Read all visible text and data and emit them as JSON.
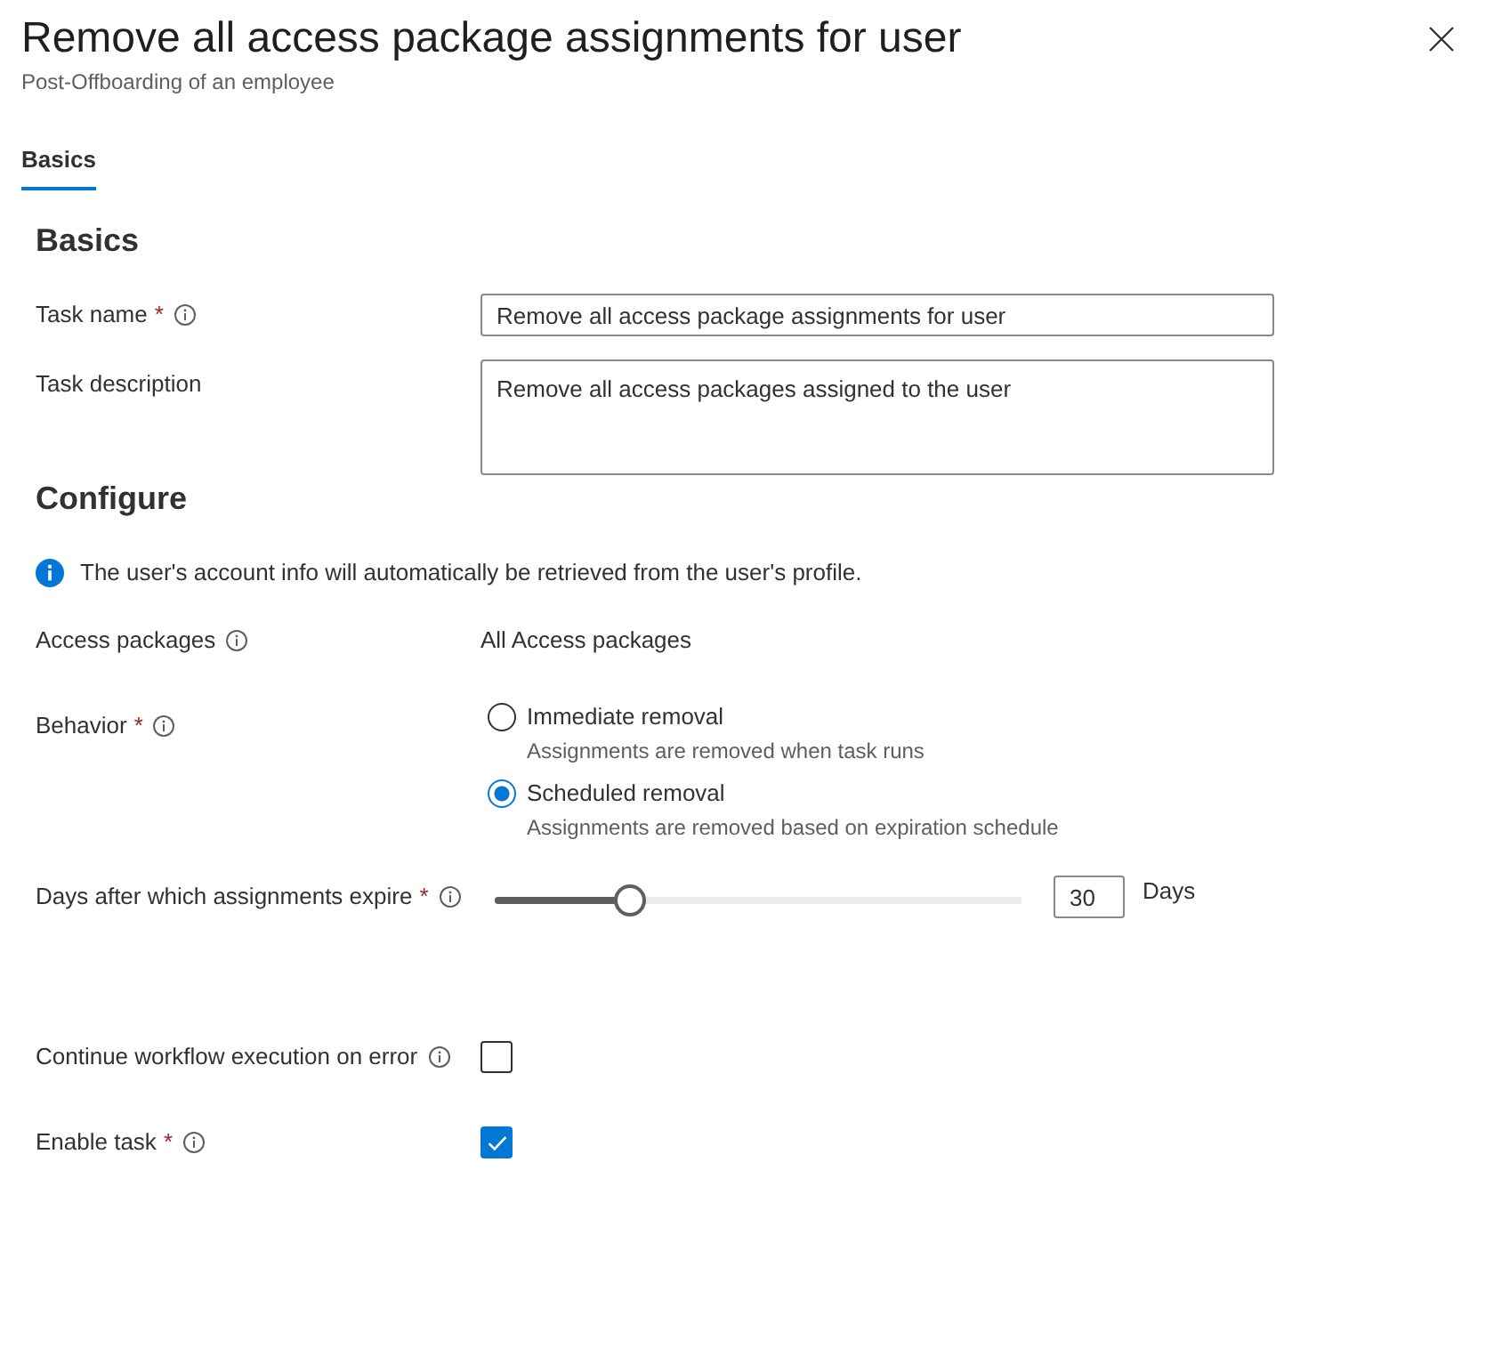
{
  "panel": {
    "title": "Remove all access package assignments for user",
    "subtitle": "Post-Offboarding of an employee"
  },
  "tabs": [
    {
      "label": "Basics",
      "selected": true
    }
  ],
  "basics": {
    "heading": "Basics",
    "fields": [
      {
        "kind": "text",
        "label": "Task name",
        "required_mark": "*",
        "info": true,
        "value": "Remove all access package assignments for user"
      },
      {
        "kind": "textarea",
        "label": "Task description",
        "info": false,
        "value": "Remove all access packages assigned to the user"
      }
    ]
  },
  "configure": {
    "heading": "Configure",
    "notice": "The user's account info will automatically be retrieved from the user's profile.",
    "fields": [
      {
        "kind": "static",
        "label": "Access packages",
        "info": true,
        "value": "All Access packages"
      },
      {
        "kind": "radio",
        "label": "Behavior",
        "required_mark": "*",
        "info": true,
        "options": [
          {
            "label": "Immediate removal",
            "description": "Assignments are removed when task runs",
            "selected": false
          },
          {
            "label": "Scheduled removal",
            "description": "Assignments are removed based on expiration schedule",
            "selected": true
          }
        ]
      },
      {
        "kind": "slider",
        "label": "Days after which assignments expire",
        "required_mark": "*",
        "info": true,
        "level": 0.24,
        "value": "30",
        "unit": "Days"
      },
      {
        "kind": "checkbox",
        "label": "Continue workflow execution on error",
        "info": true,
        "checked": false
      },
      {
        "kind": "checkbox",
        "label": "Enable task",
        "required_mark": "*",
        "info": true,
        "checked": true
      }
    ]
  }
}
